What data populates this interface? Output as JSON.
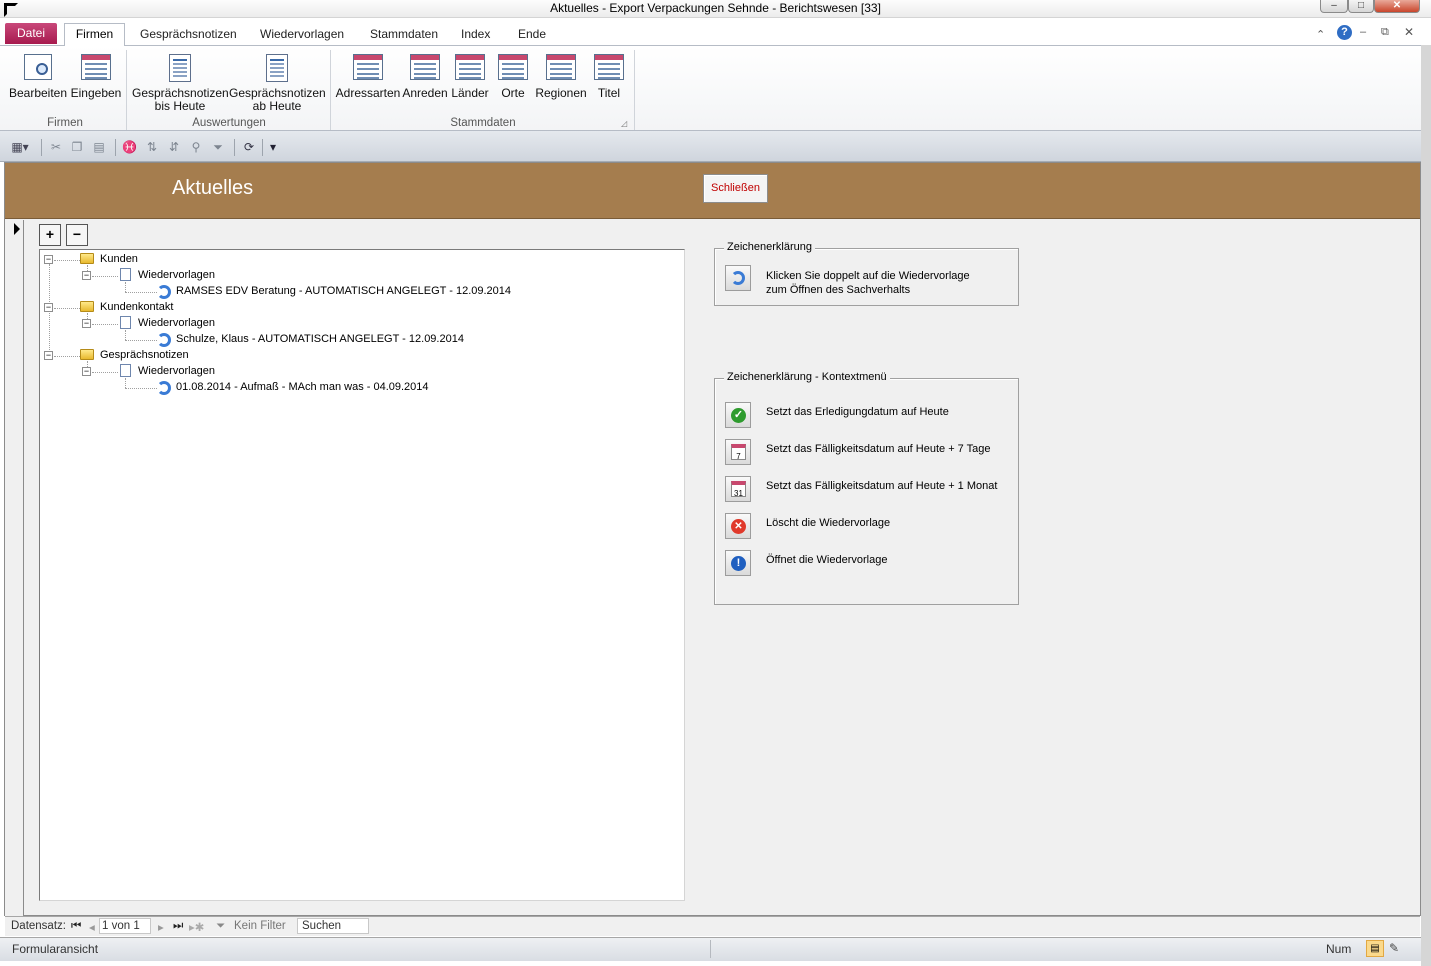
{
  "window": {
    "title": "Aktuelles  -  Export Verpackungen Sehnde - Berichtswesen [33]",
    "controls": {
      "minimize": "–",
      "maximize": "□",
      "close": "✕"
    }
  },
  "ribbon": {
    "file_tab": "Datei",
    "tabs": [
      "Firmen",
      "Gesprächsnotizen",
      "Wiedervorlagen",
      "Stammdaten",
      "Index",
      "Ende"
    ],
    "groups": {
      "firmen": {
        "label": "Firmen",
        "buttons": [
          "Bearbeiten",
          "Eingeben"
        ]
      },
      "auswertungen": {
        "label": "Auswertungen",
        "buttons": [
          {
            "line1": "Gesprächsnotizen",
            "line2": "bis Heute"
          },
          {
            "line1": "Gesprächsnotizen",
            "line2": "ab Heute"
          }
        ]
      },
      "stammdaten": {
        "label": "Stammdaten",
        "buttons": [
          "Adressarten",
          "Anreden",
          "Länder",
          "Orte",
          "Regionen",
          "Titel"
        ]
      }
    }
  },
  "form": {
    "title": "Aktuelles",
    "close_button": "Schließen",
    "expand_all": "+",
    "collapse_all": "−"
  },
  "tree": {
    "groups": [
      {
        "label": "Kunden",
        "child": "Wiedervorlagen",
        "item": "RAMSES EDV Beratung - AUTOMATISCH ANGELEGT - 12.09.2014"
      },
      {
        "label": "Kundenkontakt",
        "child": "Wiedervorlagen",
        "item": "Schulze, Klaus - AUTOMATISCH ANGELEGT - 12.09.2014"
      },
      {
        "label": "Gesprächsnotizen",
        "child": "Wiedervorlagen",
        "item": "01.08.2014 - Aufmaß - MAch man was - 04.09.2014"
      }
    ]
  },
  "legend1": {
    "title": "Zeichenerklärung",
    "line1": "Klicken Sie doppelt auf die Wiedervorlage",
    "line2": "zum Öffnen des Sachverhalts",
    "icon": "refresh-icon"
  },
  "legend2": {
    "title": "Zeichenerklärung - Kontextmenü",
    "items": [
      {
        "icon": "check-icon",
        "text": "Setzt das Erledigungdatum auf Heute"
      },
      {
        "icon": "calendar-7-icon",
        "text": "Setzt das Fälligkeitsdatum auf Heute + 7 Tage"
      },
      {
        "icon": "calendar-31-icon",
        "text": "Setzt das Fälligkeitsdatum auf Heute + 1 Monat"
      },
      {
        "icon": "delete-icon",
        "text": "Löscht die Wiedervorlage"
      },
      {
        "icon": "info-icon",
        "text": "Öffnet die Wiedervorlage"
      }
    ],
    "cal7": "7",
    "cal31": "31"
  },
  "navbar": {
    "label": "Datensatz:",
    "record": "1 von 1",
    "filter": "Kein Filter",
    "search": "Suchen"
  },
  "statusbar": {
    "view": "Formularansicht",
    "num": "Num"
  },
  "colors": {
    "header": "#a57d4e",
    "file_tab": "#b62962",
    "close_text": "#c00000"
  }
}
